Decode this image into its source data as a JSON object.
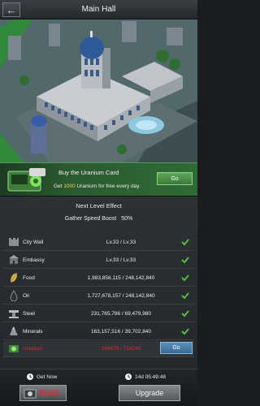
{
  "header": {
    "title": "Main Hall",
    "back_icon": "back-arrow-icon"
  },
  "uranium_card": {
    "title": "Buy the Uranium Card",
    "desc_prefix": "Get ",
    "desc_amount": "1000",
    "desc_suffix": " Uranium for free every day.",
    "go_label": "Go"
  },
  "next_level": {
    "heading": "Next Level Effect",
    "effect_name": "Gather Speed Boost",
    "effect_value": "50%"
  },
  "requirements": [
    {
      "label": "City Wall",
      "value": "Lv.33 / Lv.33",
      "icon": "wall-icon",
      "met": true
    },
    {
      "label": "Embassy",
      "value": "Lv.33 / Lv.33",
      "icon": "embassy-icon",
      "met": true
    },
    {
      "label": "Food",
      "value": "1,983,858,115 / 248,142,840",
      "icon": "food-icon",
      "met": true
    },
    {
      "label": "Oil",
      "value": "1,727,678,157 / 248,142,840",
      "icon": "oil-icon",
      "met": true
    },
    {
      "label": "Steel",
      "value": "231,765,786 / 69,479,980",
      "icon": "steel-icon",
      "met": true
    },
    {
      "label": "Minerals",
      "value": "163,157,516 / 39,702,840",
      "icon": "minerals-icon",
      "met": true
    },
    {
      "label": "Uranium",
      "value": "166679 / 714240",
      "icon": "uranium-icon",
      "met": false,
      "action_label": "Go"
    }
  ],
  "footer": {
    "get_now_label": "Get Now",
    "uranium_cost": "51203",
    "timer": "14d 05:49:48",
    "upgrade_label": "Upgrade"
  },
  "colors": {
    "accent_green": "#4fbf3c",
    "warning_red": "#e0292b",
    "highlight_yellow": "#f6d24a"
  }
}
